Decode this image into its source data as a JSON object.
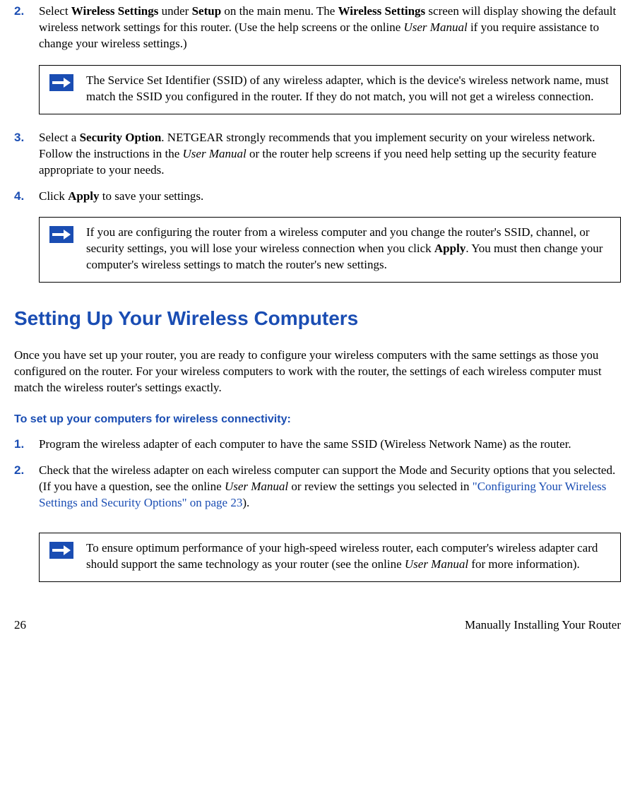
{
  "steps_top": [
    {
      "num": "2.",
      "parts": [
        {
          "t": "Select "
        },
        {
          "t": "Wireless Settings",
          "b": true
        },
        {
          "t": " under "
        },
        {
          "t": "Setup",
          "b": true
        },
        {
          "t": " on the main menu. The "
        },
        {
          "t": "Wireless Settings",
          "b": true
        },
        {
          "t": " screen will display showing the default wireless network settings for this router. (Use the help screens or the online "
        },
        {
          "t": "User Manual",
          "i": true
        },
        {
          "t": " if you require assistance to change your wireless settings.)"
        }
      ]
    },
    {
      "num": "3.",
      "parts": [
        {
          "t": "Select a "
        },
        {
          "t": "Security Option",
          "b": true
        },
        {
          "t": ". NETGEAR strongly recommends that you implement security on your wireless network. Follow the instructions in the "
        },
        {
          "t": "User Manual",
          "i": true
        },
        {
          "t": " or the router help screens if you need help setting up the security feature appropriate to your needs."
        }
      ]
    },
    {
      "num": "4.",
      "parts": [
        {
          "t": "Click "
        },
        {
          "t": "Apply",
          "b": true
        },
        {
          "t": " to save your settings."
        }
      ]
    }
  ],
  "note1": "The Service Set Identifier (SSID) of any wireless adapter, which is the device's wireless network name, must match the SSID you configured in the router. If they do not match, you will not get a wireless connection.",
  "note2_parts": [
    {
      "t": "If you are configuring the router from a wireless computer and you change the router's SSID, channel, or security settings, you will lose your wireless connection when you click "
    },
    {
      "t": "Apply",
      "b": true
    },
    {
      "t": ". You must then change your computer's wireless settings to match the router's new settings."
    }
  ],
  "heading": "Setting Up Your Wireless Computers",
  "intro": "Once you have set up your router, you are ready to configure your wireless computers with the same settings as those you configured on the router. For your wireless computers to work with the router, the settings of each wireless computer must match the wireless router's settings exactly.",
  "subhead": "To set up your computers for wireless connectivity:",
  "steps_bottom": [
    {
      "num": "1.",
      "parts": [
        {
          "t": "Program the wireless adapter of each computer to have the same SSID (Wireless Network Name) as the router."
        }
      ]
    },
    {
      "num": "2.",
      "parts": [
        {
          "t": "Check that the wireless adapter on each wireless computer can support the Mode and Security options that you selected. (If you have a question, see the online "
        },
        {
          "t": "User Manual",
          "i": true
        },
        {
          "t": " or review the settings you selected in "
        },
        {
          "t": "\"Configuring Your Wireless Settings and Security Options\" on page 23",
          "link": true
        },
        {
          "t": ")."
        }
      ]
    }
  ],
  "note3_parts": [
    {
      "t": "To ensure optimum performance of your high-speed wireless router, each computer's wireless adapter card should support the same technology as your router (see the online "
    },
    {
      "t": "User Manual",
      "i": true
    },
    {
      "t": " for more information)."
    }
  ],
  "footer_left": "26",
  "footer_right": "Manually Installing Your Router"
}
